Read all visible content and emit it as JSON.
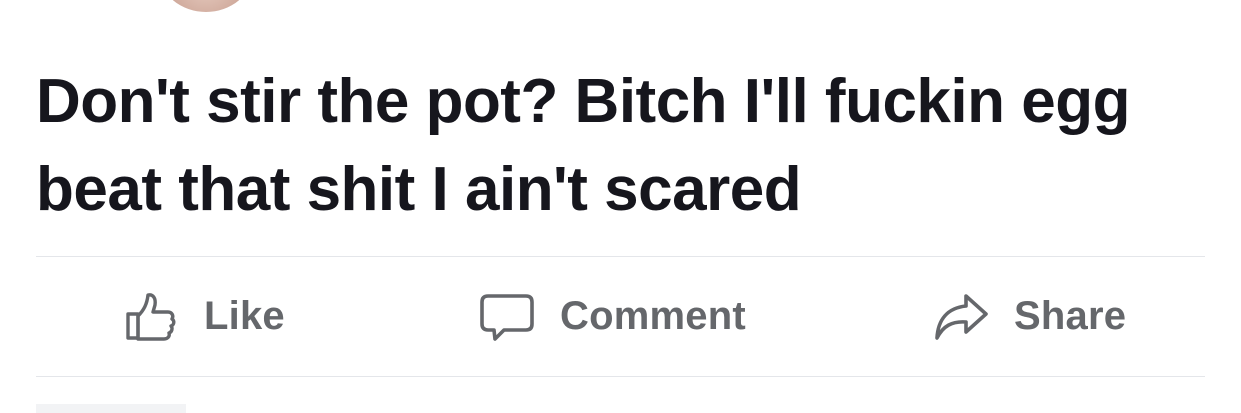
{
  "post": {
    "text": "Don't stir the pot? Bitch I'll fuckin egg beat that shit I ain't scared"
  },
  "actions": {
    "like": {
      "label": "Like",
      "icon": "thumbs-up-icon"
    },
    "comment": {
      "label": "Comment",
      "icon": "speech-bubble-icon"
    },
    "share": {
      "label": "Share",
      "icon": "share-arrow-icon"
    }
  },
  "colors": {
    "text": "#16161d",
    "action_text": "#65676b",
    "divider": "#e4e6ea"
  }
}
